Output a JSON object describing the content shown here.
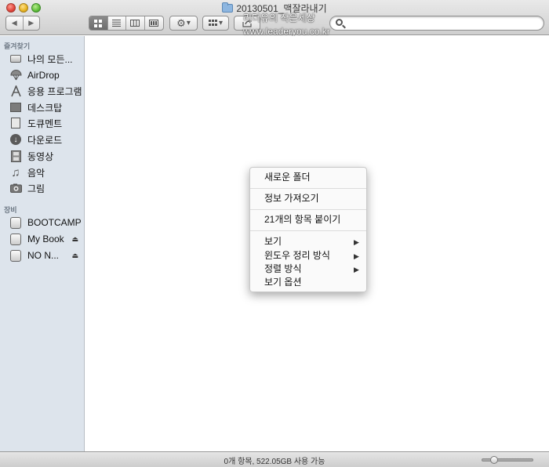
{
  "window": {
    "title": "20130501_맥잘라내기"
  },
  "watermark": {
    "line1": "리더유의 작은세상",
    "line2": "www.leaderyou.co.kr"
  },
  "toolbar": {
    "back": "◀",
    "forward": "▶",
    "action_arrow": "▾",
    "arrange_arrow": "▾"
  },
  "sidebar": {
    "favorites_header": "즐겨찾기",
    "favorites": [
      {
        "label": "나의 모든...",
        "icon": "all-files-icon"
      },
      {
        "label": "AirDrop",
        "icon": "airdrop-icon"
      },
      {
        "label": "응용 프로그램",
        "icon": "applications-icon"
      },
      {
        "label": "데스크탑",
        "icon": "desktop-icon"
      },
      {
        "label": "도큐멘트",
        "icon": "documents-icon"
      },
      {
        "label": "다운로드",
        "icon": "downloads-icon"
      },
      {
        "label": "동영상",
        "icon": "movies-icon"
      },
      {
        "label": "음악",
        "icon": "music-icon"
      },
      {
        "label": "그림",
        "icon": "pictures-icon"
      }
    ],
    "devices_header": "장비",
    "devices": [
      {
        "label": "BOOTCAMP",
        "icon": "drive-icon",
        "eject": ""
      },
      {
        "label": "My Book",
        "icon": "drive-icon",
        "eject": "⏏"
      },
      {
        "label": "NO N...",
        "icon": "drive-icon",
        "eject": "⏏"
      }
    ]
  },
  "context_menu": {
    "new_folder": "새로운 폴더",
    "get_info": "정보 가져오기",
    "paste_items": "21개의 항목 붙이기",
    "view": "보기",
    "arrange": "윈도우 정리 방식",
    "sort": "정렬 방식",
    "view_options": "보기 옵션",
    "submenu_arrow": "▶"
  },
  "status_bar": {
    "text": "0개 항목, 522.05GB 사용 가능"
  }
}
